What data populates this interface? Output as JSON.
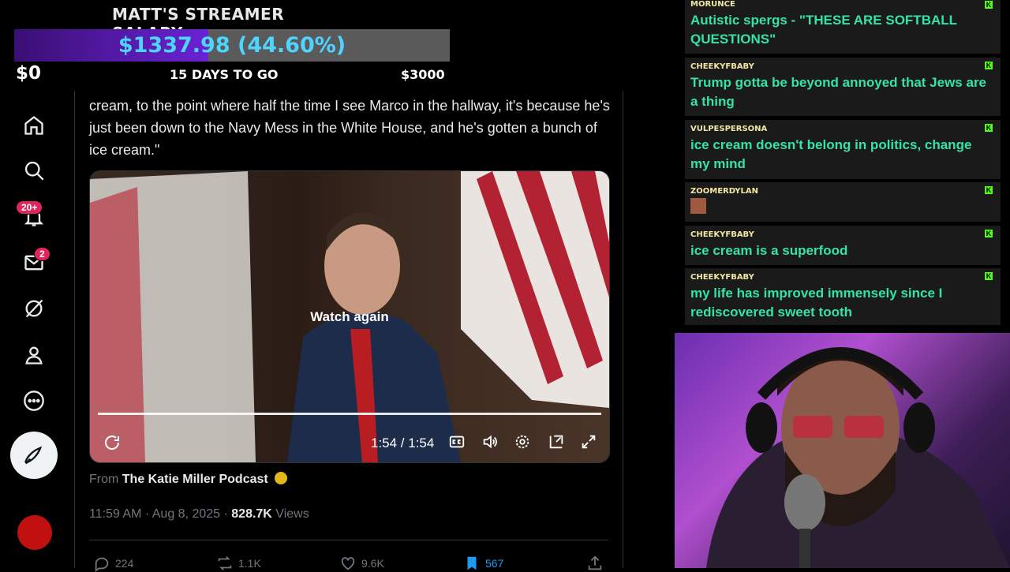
{
  "salary_overlay": {
    "title": "MATT'S STREAMER SALARY",
    "amount": "$1337.98 (44.60%)",
    "progress_fraction": 0.446,
    "min_label": "$0",
    "days_label": "15 DAYS TO GO",
    "max_label": "$3000"
  },
  "nav": {
    "notifications_badge": "20+",
    "messages_badge": "2",
    "icons": [
      "home-icon",
      "search-icon",
      "bell-icon",
      "mail-icon",
      "grok-icon",
      "profile-icon",
      "more-icon",
      "post-icon"
    ]
  },
  "tweet": {
    "text": "cream, to the point where half the time I see Marco in the hallway, it's because he's just been down to the Navy Mess in the White House, and he's gotten a bunch of ice cream.\"",
    "video": {
      "overlay_label": "Watch again",
      "time": "1:54 / 1:54",
      "progress_fraction": 1.0
    },
    "from_prefix": "From",
    "source": "The Katie Miller Podcast",
    "timestamp": "11:59 AM · Aug 8, 2025 · ",
    "views_count": "828.7K",
    "views_label": " Views",
    "stats": {
      "replies": "224",
      "reposts": "1.1K",
      "likes": "9.6K",
      "bookmarks": "567"
    }
  },
  "chat": {
    "messages": [
      {
        "user": "MORUNCE",
        "text": "Autistic spergs - \"THESE ARE SOFTBALL QUESTIONS\""
      },
      {
        "user": "CHEEKYFBABY",
        "text": "Trump gotta be beyond annoyed that Jews are a thing"
      },
      {
        "user": "VULPESPERSONA",
        "text": "ice cream doesn't belong in politics, change my mind"
      },
      {
        "user": "ZOOMERDYLAN",
        "text": ""
      },
      {
        "user": "CHEEKYFBABY",
        "text": "ice cream is a superfood"
      },
      {
        "user": "CHEEKYFBABY",
        "text": "my life has improved immensely since I rediscovered sweet tooth"
      }
    ],
    "badge_letter": "K"
  },
  "colors": {
    "accent_blue": "#1d9bf0",
    "chat_text": "#34e3a6",
    "salary_text": "#4fd3ff",
    "badge_red": "#e0245e"
  }
}
